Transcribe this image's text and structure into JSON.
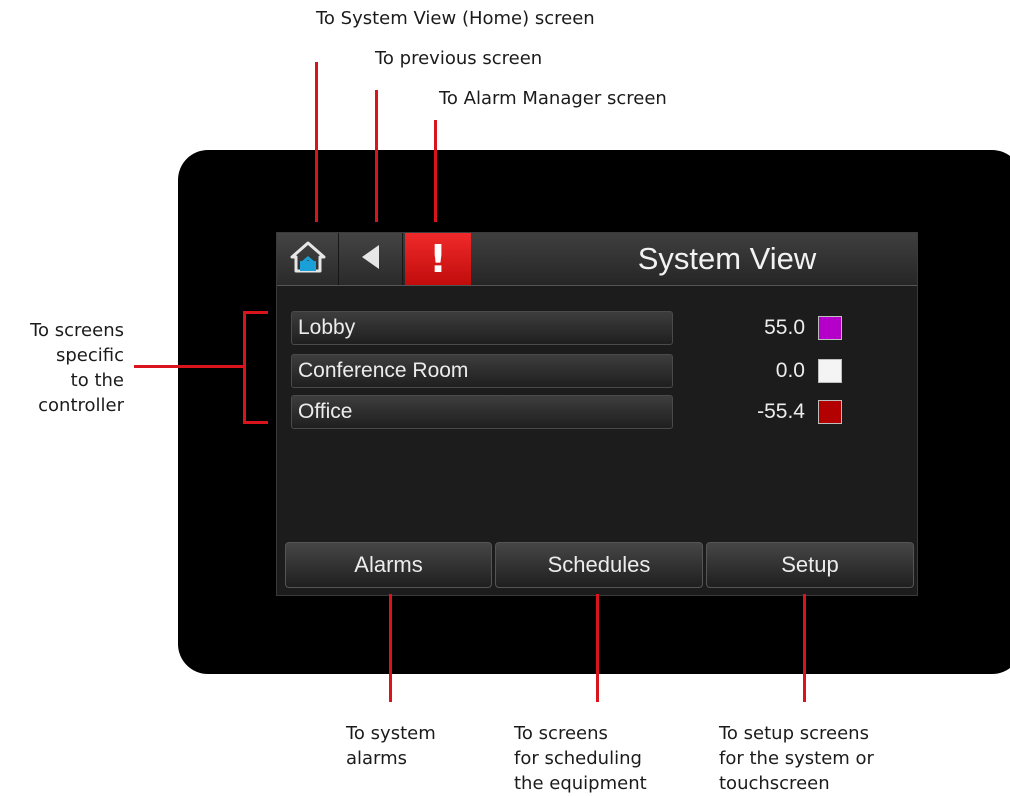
{
  "callouts": {
    "home": "To System View (Home) screen",
    "previous": "To previous screen",
    "alarm_manager": "To Alarm Manager screen",
    "controller": "To screens\nspecific\nto the\ncontroller",
    "system_alarms": "To system\nalarms",
    "scheduling": "To screens\nfor scheduling\nthe equipment",
    "setup": "To setup screens\nfor the system or\ntouchscreen"
  },
  "screen": {
    "title": "System View",
    "alarm_symbol": "!",
    "rows": [
      {
        "label": "Lobby",
        "value": "55.0",
        "color": "#b400c8"
      },
      {
        "label": "Conference Room",
        "value": "0.0",
        "color": "#f4f4f4"
      },
      {
        "label": "Office",
        "value": "-55.4",
        "color": "#b30000"
      }
    ],
    "buttons": {
      "alarms": "Alarms",
      "schedules": "Schedules",
      "setup": "Setup"
    }
  },
  "icons": {
    "home": "home-icon",
    "back": "back-arrow-icon",
    "alarm": "alarm-exclamation-icon"
  },
  "colors": {
    "accent_red": "#d9141c",
    "alarm_red": "#e31b1b",
    "home_icon_blue": "#1aa0d6"
  }
}
